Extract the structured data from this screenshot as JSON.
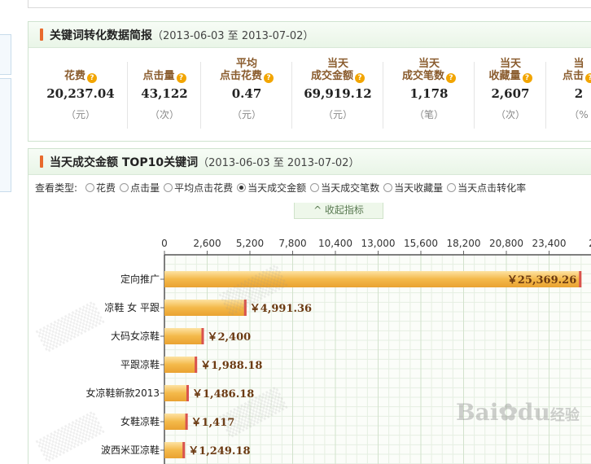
{
  "summary": {
    "title": "关键词转化数据简报",
    "range": "（2013-06-03 至 2013-07-02）",
    "metrics": [
      {
        "line1": "",
        "line2": "花费",
        "value": "20,237.04",
        "unit": "（元）"
      },
      {
        "line1": "",
        "line2": "点击量",
        "value": "43,122",
        "unit": "（次）"
      },
      {
        "line1": "平均",
        "line2": "点击花费",
        "value": "0.47",
        "unit": "（元）"
      },
      {
        "line1": "当天",
        "line2": "成交金额",
        "value": "69,919.12",
        "unit": "（元）"
      },
      {
        "line1": "当天",
        "line2": "成交笔数",
        "value": "1,178",
        "unit": "（笔）"
      },
      {
        "line1": "当天",
        "line2": "收藏量",
        "value": "2,607",
        "unit": "（次）"
      },
      {
        "line1": "当",
        "line2": "点击",
        "value": "2",
        "unit": "（%"
      }
    ],
    "help_icon": "?"
  },
  "top10": {
    "title": "当天成交金额 TOP10关键词",
    "range": "（2013-06-03 至 2013-07-02）",
    "filter_label": "查看类型:",
    "options": [
      "花费",
      "点击量",
      "平均点击花费",
      "当天成交金额",
      "当天成交笔数",
      "当天收藏量",
      "当天点击转化率"
    ],
    "selected": "当天成交金额",
    "collapse_label": "^  收起指标"
  },
  "chart_data": {
    "type": "bar",
    "orientation": "horizontal",
    "categories": [
      "定向推广",
      "凉鞋 女 平跟",
      "大码女凉鞋",
      "平跟凉鞋",
      "女凉鞋新款2013",
      "女鞋凉鞋",
      "波西米亚凉鞋"
    ],
    "values": [
      25369.26,
      4991.36,
      2400,
      1988.18,
      1486.18,
      1417,
      1249.18
    ],
    "value_labels": [
      "￥25,369.26",
      "￥4,991.36",
      "￥2,400",
      "￥1,988.18",
      "￥1,486.18",
      "￥1,417",
      "￥1,249.18"
    ],
    "x_ticks": [
      "0",
      "2,600",
      "5,200",
      "7,800",
      "10,400",
      "13,000",
      "15,600",
      "18,200",
      "20,800",
      "23,400",
      "2"
    ],
    "xlim": [
      0,
      26000
    ],
    "grid": true,
    "bar_color": "#f4b94a",
    "bar_end_color": "#d9534f"
  },
  "watermark": {
    "brand": "Bai",
    "brand2": "du",
    "suffix": "经验"
  }
}
